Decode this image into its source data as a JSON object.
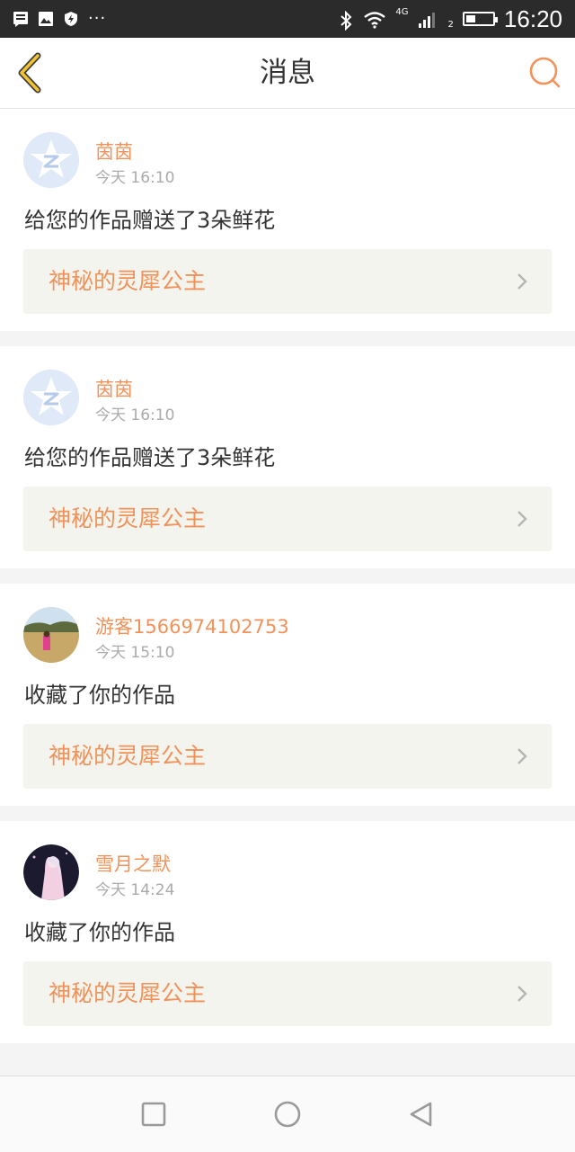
{
  "status_bar": {
    "time": "16:20",
    "network": "4G",
    "sim": "2",
    "battery_level": 0.35,
    "icons": [
      "message-icon",
      "image-icon",
      "shield-bolt-icon",
      "more-dots-icon",
      "bluetooth-icon",
      "wifi-icon",
      "signal-icon",
      "battery-icon"
    ]
  },
  "header": {
    "title": "消息",
    "back_icon": "chevron-left-icon",
    "search_icon": "search-icon"
  },
  "messages": [
    {
      "name": "茵茵",
      "time": "今天 16:10",
      "text": "给您的作品赠送了3朵鲜花",
      "work_title": "神秘的灵犀公主",
      "avatar": "default"
    },
    {
      "name": "茵茵",
      "time": "今天 16:10",
      "text": "给您的作品赠送了3朵鲜花",
      "work_title": "神秘的灵犀公主",
      "avatar": "default"
    },
    {
      "name": "游客1566974102753",
      "time": "今天 15:10",
      "text": "收藏了你的作品",
      "work_title": "神秘的灵犀公主",
      "avatar": "landscape-photo"
    },
    {
      "name": "雪月之默",
      "time": "今天 14:24",
      "text": "收藏了你的作品",
      "work_title": "神秘的灵犀公主",
      "avatar": "anime-girl"
    }
  ],
  "system_nav": [
    "recent-apps-icon",
    "home-icon",
    "back-triangle-icon"
  ],
  "colors": {
    "accent": "#f0925a",
    "back_icon": "#f3c233",
    "status_bar": "#2b2b2b"
  }
}
